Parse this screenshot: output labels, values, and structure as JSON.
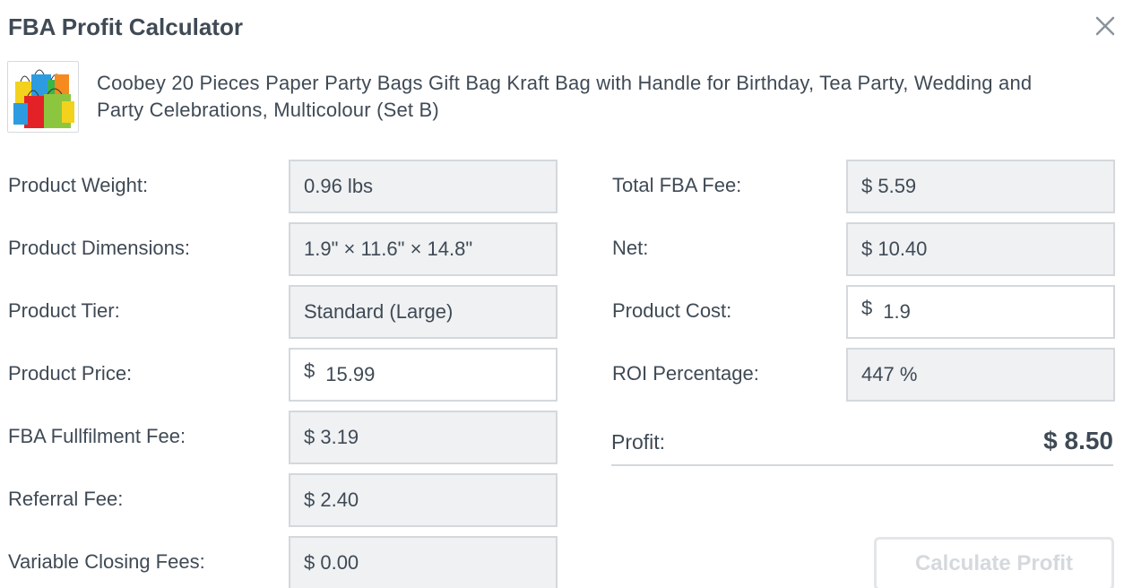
{
  "modal": {
    "title": "FBA Profit Calculator",
    "close_icon": "close-icon"
  },
  "product": {
    "image_icon": "gift-bags-image",
    "title": "Coobey 20 Pieces Paper Party Bags Gift Bag Kraft Bag with Handle for Birthday, Tea Party, Wedding and Party Celebrations, Multicolour (Set B)"
  },
  "left": {
    "weight": {
      "label": "Product Weight:",
      "value": "0.96 lbs"
    },
    "dimensions": {
      "label": "Product Dimensions:",
      "value": "1.9\" × 11.6\" × 14.8\""
    },
    "tier": {
      "label": "Product Tier:",
      "value": "Standard (Large)"
    },
    "price": {
      "label": "Product Price:",
      "currency": "$",
      "value": "15.99"
    },
    "fulfilment": {
      "label": "FBA Fullfilment Fee:",
      "value": "$ 3.19"
    },
    "referral": {
      "label": "Referral Fee:",
      "value": "$ 2.40"
    },
    "closing": {
      "label": "Variable Closing Fees:",
      "value": "$ 0.00"
    }
  },
  "right": {
    "total_fee": {
      "label": "Total FBA Fee:",
      "value": "$ 5.59"
    },
    "net": {
      "label": "Net:",
      "value": "$ 10.40"
    },
    "cost": {
      "label": "Product Cost:",
      "currency": "$",
      "value": "1.9"
    },
    "roi": {
      "label": "ROI Percentage:",
      "value": "447 %"
    },
    "profit": {
      "label": "Profit:",
      "value": "$ 8.50"
    },
    "calculate_label": "Calculate Profit"
  },
  "colors": {
    "text": "#3f4a55",
    "readonly_bg": "#eff1f3",
    "border": "#d4d8dc",
    "button_disabled_text": "#d5d9dd"
  }
}
